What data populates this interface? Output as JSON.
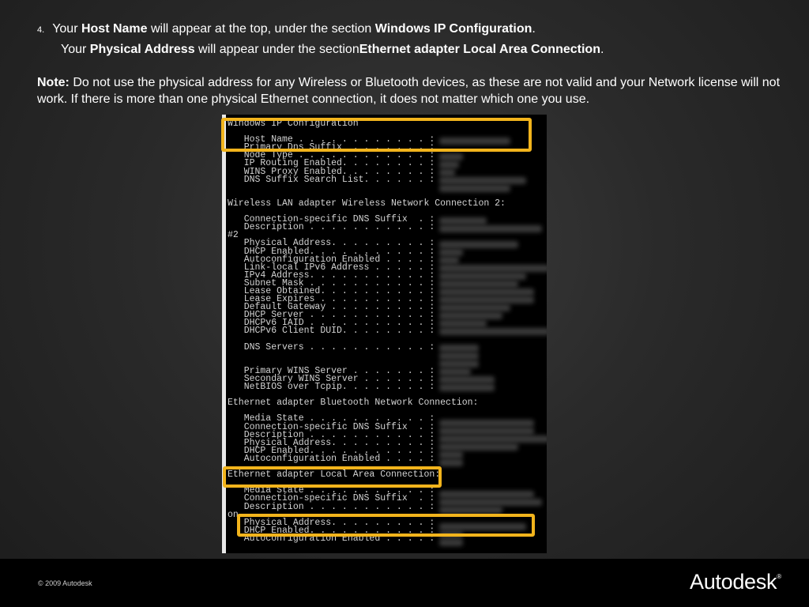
{
  "instructions": {
    "step_number": "4.",
    "line1": {
      "pre": "Your ",
      "bold1": "Host Name",
      "mid": " will appear at the top, under the section ",
      "bold2": "Windows IP Configuration",
      "post": "."
    },
    "line2": {
      "pre": "Your ",
      "bold1": "Physical Address",
      "mid": " will appear under the section",
      "bold2": "Ethernet adapter Local Area Connection",
      "post": "."
    },
    "note": {
      "label": "Note:",
      "text": " Do not use the physical address for any Wireless or Bluetooth devices, as these are not valid and your Network license will not work.  If there is more than one physical Ethernet connection, it does not matter which one you use."
    }
  },
  "console_lines": [
    "Windows IP Configuration",
    "",
    "   Host Name . . . . . . . . . . . . :",
    "   Primary Dns Suffix  . . . . . . . :",
    "   Node Type . . . . . . . . . . . . :",
    "   IP Routing Enabled. . . . . . . . :",
    "   WINS Proxy Enabled. . . . . . . . :",
    "   DNS Suffix Search List. . . . . . :",
    "",
    "",
    "Wireless LAN adapter Wireless Network Connection 2:",
    "",
    "   Connection-specific DNS Suffix  . :",
    "   Description . . . . . . . . . . . :",
    "#2",
    "   Physical Address. . . . . . . . . :",
    "   DHCP Enabled. . . . . . . . . . . :",
    "   Autoconfiguration Enabled . . . . :",
    "   Link-local IPv6 Address . . . . . :",
    "   IPv4 Address. . . . . . . . . . . :",
    "   Subnet Mask . . . . . . . . . . . :",
    "   Lease Obtained. . . . . . . . . . :",
    "   Lease Expires . . . . . . . . . . :",
    "   Default Gateway . . . . . . . . . :",
    "   DHCP Server . . . . . . . . . . . :",
    "   DHCPv6 IAID . . . . . . . . . . . :",
    "   DHCPv6 Client DUID. . . . . . . . :",
    "",
    "   DNS Servers . . . . . . . . . . . :",
    "",
    "",
    "   Primary WINS Server . . . . . . . :",
    "   Secondary WINS Server . . . . . . :",
    "   NetBIOS over Tcpip. . . . . . . . :",
    "",
    "Ethernet adapter Bluetooth Network Connection:",
    "",
    "   Media State . . . . . . . . . . . :",
    "   Connection-specific DNS Suffix  . :",
    "   Description . . . . . . . . . . . :",
    "   Physical Address. . . . . . . . . :",
    "   DHCP Enabled. . . . . . . . . . . :",
    "   Autoconfiguration Enabled . . . . :",
    "",
    "Ethernet adapter Local Area Connection:",
    "",
    "   Media State . . . . . . . . . . . :",
    "   Connection-specific DNS Suffix  . :",
    "   Description . . . . . . . . . . . :",
    "on",
    "   Physical Address. . . . . . . . . :",
    "   DHCP Enabled. . . . . . . . . . . :",
    "   Autoconfiguration Enabled . . . . :"
  ],
  "colors": {
    "highlight": "#f2b41c",
    "background": "#2a2a2a",
    "console_bg": "#000000",
    "footer_bg": "#000000"
  },
  "footer": {
    "copyright": "© 2009 Autodesk",
    "logo_text": "Autodesk",
    "logo_mark": "®"
  }
}
